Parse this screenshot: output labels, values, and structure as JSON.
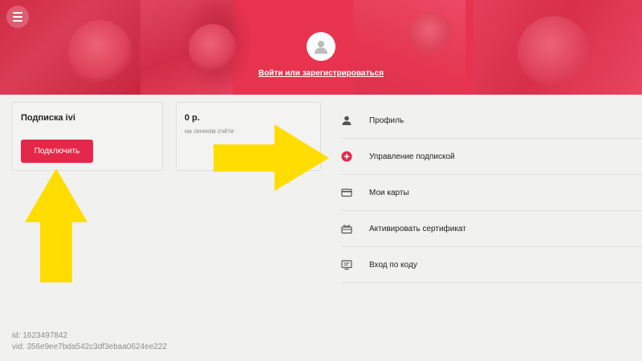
{
  "header": {
    "menu_icon": "hamburger-icon",
    "avatar_icon": "user-avatar-icon",
    "login_link": "Войти или зарегистрироваться"
  },
  "subscription_card": {
    "title": "Подписка ivi",
    "connect_button": "Подключить"
  },
  "balance_card": {
    "amount": "0 р.",
    "caption": "на личном счёте"
  },
  "menu": {
    "items": [
      {
        "label": "Профиль",
        "icon": "profile-icon"
      },
      {
        "label": "Управление подпиской",
        "icon": "plus-circle-icon"
      },
      {
        "label": "Мои карты",
        "icon": "card-icon"
      },
      {
        "label": "Активировать сертификат",
        "icon": "gift-icon"
      },
      {
        "label": "Вход по коду",
        "icon": "tv-code-icon"
      }
    ]
  },
  "footer": {
    "id_line": "id: 1623497842",
    "vid_line": "vid: 356e9ee7bda542c3df3ebaa0624ee222"
  },
  "colors": {
    "brand": "#e5284a",
    "hero": "#e8334f",
    "arrow": "#ffdd00",
    "background": "#f1f1f0"
  }
}
